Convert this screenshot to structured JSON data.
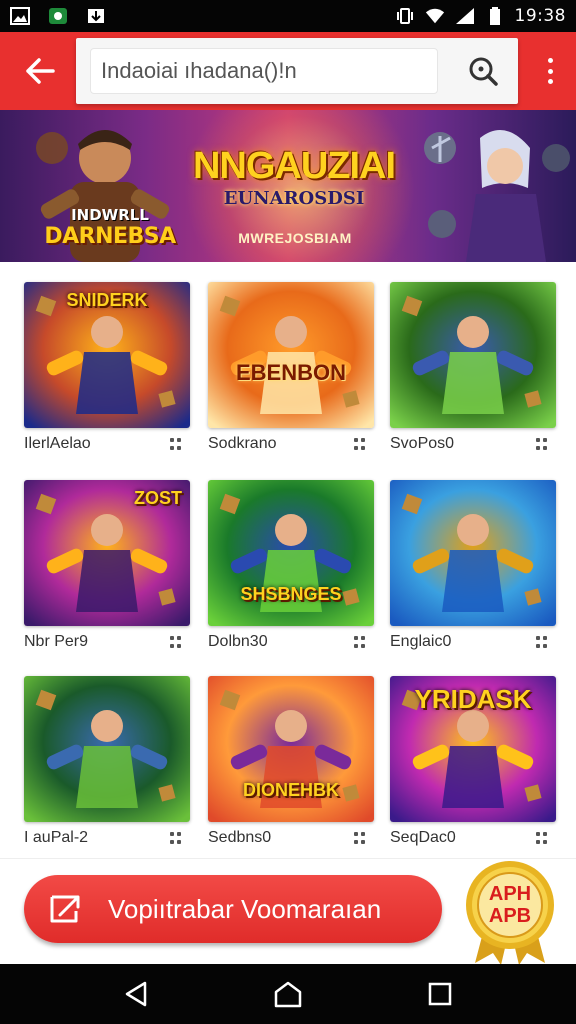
{
  "status_bar": {
    "time": "19:38",
    "left_icons": [
      "image-icon",
      "app-notification-icon",
      "download-icon"
    ],
    "right_icons": [
      "vibrate-icon",
      "wifi-icon",
      "signal-icon",
      "battery-icon"
    ]
  },
  "app_bar": {
    "search_value": "Indaoiai ıhadana()!n",
    "color": "#e8302f"
  },
  "banner": {
    "title": "NNGAUZIAI",
    "subtitle": "EUNAROSDSI",
    "tagline": "MWREJOSBIAM",
    "badge_line1": "INDWRLL",
    "badge_line2": "DARNEBSA"
  },
  "games": [
    {
      "title": "IlerlAelao",
      "thumb_text": "SNIDERK",
      "colors": [
        "#1b2a8a",
        "#c64a2a",
        "#ffb21a"
      ]
    },
    {
      "title": "Sodkrano",
      "thumb_text": "EBENBON",
      "colors": [
        "#ffe6a8",
        "#e86a1a",
        "#ff9b2a"
      ]
    },
    {
      "title": "SvoPos0",
      "thumb_text": "",
      "colors": [
        "#7ad04a",
        "#2a6a1a",
        "#3a5ab0"
      ]
    },
    {
      "title": "Nbr Per9",
      "thumb_text": "ZOST",
      "colors": [
        "#3a1a6a",
        "#b02a9a",
        "#ffb21a"
      ]
    },
    {
      "title": "Dolbn30",
      "thumb_text": "SHSBNGES",
      "colors": [
        "#6ad03a",
        "#1a7a2a",
        "#2a4ab0"
      ]
    },
    {
      "title": "Englaic0",
      "thumb_text": "",
      "colors": [
        "#1a5ac0",
        "#3aa0e0",
        "#e0a01a"
      ]
    },
    {
      "title": "I auPal-2",
      "thumb_text": "",
      "colors": [
        "#6ac03a",
        "#1a5a2a",
        "#3a6ab0"
      ]
    },
    {
      "title": "Sedbns0",
      "thumb_text": "DIONEHBK",
      "colors": [
        "#e04a2a",
        "#ff9a3a",
        "#7a2a9a"
      ]
    },
    {
      "title": "SeqDac0",
      "thumb_text": "YRIDASK",
      "colors": [
        "#3a1a8a",
        "#c02ab0",
        "#ffc21a"
      ]
    }
  ],
  "cta": {
    "label": "Vopiıtrabar Voomaraıan"
  },
  "apk_badge": {
    "line1": "APH",
    "line2": "APB"
  },
  "nav_bar": {
    "buttons": [
      "back-triangle-icon",
      "home-icon",
      "recents-square-icon"
    ]
  }
}
